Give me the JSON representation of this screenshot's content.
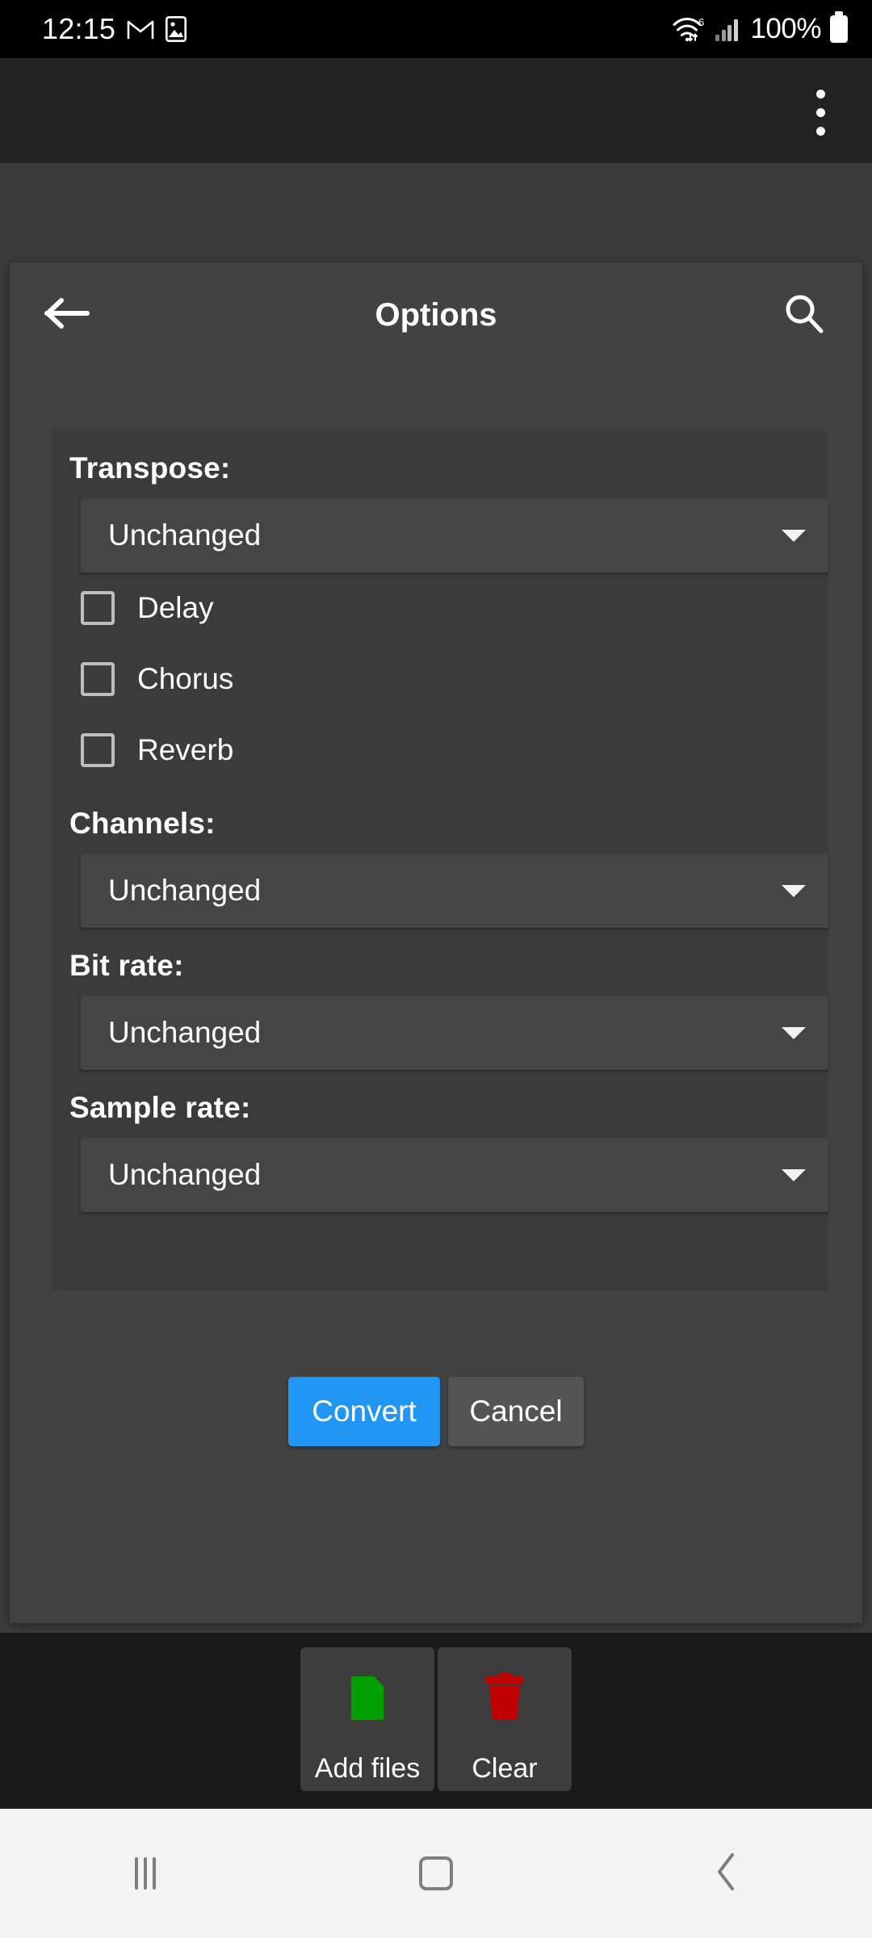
{
  "status_bar": {
    "time": "12:15",
    "battery_percent": "100%",
    "icons": [
      "gmail-icon",
      "photos-icon",
      "wifi-icon",
      "cellular-signal-icon",
      "battery-icon"
    ],
    "wifi_generation": "6"
  },
  "app_bar": {
    "overflow_menu_label": "More options"
  },
  "dialog": {
    "title": "Options",
    "back_icon": "arrow-left-icon",
    "search_icon": "search-icon",
    "sections": {
      "transpose": {
        "label": "Transpose:",
        "value": "Unchanged"
      },
      "channels": {
        "label": "Channels:",
        "value": "Unchanged"
      },
      "bit_rate": {
        "label": "Bit rate:",
        "value": "Unchanged"
      },
      "sample_rate": {
        "label": "Sample rate:",
        "value": "Unchanged"
      }
    },
    "checkboxes": [
      {
        "label": "Delay",
        "checked": false
      },
      {
        "label": "Chorus",
        "checked": false
      },
      {
        "label": "Reverb",
        "checked": false
      }
    ],
    "actions": {
      "convert_label": "Convert",
      "cancel_label": "Cancel",
      "convert_color": "#2196f3",
      "cancel_color": "#545454"
    }
  },
  "bottom_toolbar": {
    "buttons": [
      {
        "label": "Add files",
        "icon": "file-icon",
        "icon_color": "#00a000"
      },
      {
        "label": "Clear",
        "icon": "trash-icon",
        "icon_color": "#c00000"
      }
    ]
  },
  "nav_bar": {
    "recents_icon": "recents-icon",
    "home_icon": "home-icon",
    "back_icon": "back-chevron-icon"
  }
}
